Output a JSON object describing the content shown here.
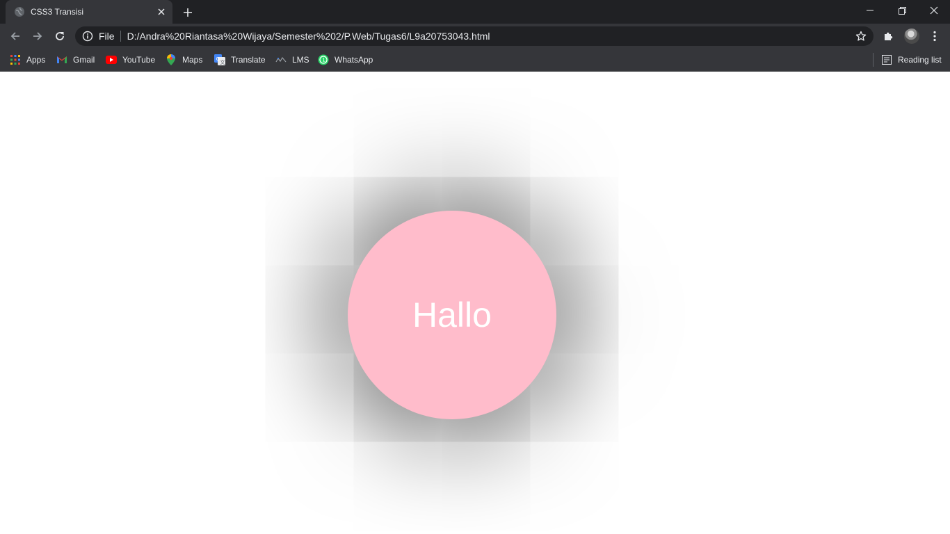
{
  "tab": {
    "title": "CSS3 Transisi",
    "favicon": "globe-icon"
  },
  "omnibox": {
    "scheme_label": "File",
    "url": "D:/Andra%20Riantasa%20Wijaya/Semester%202/P.Web/Tugas6/L9a20753043.html"
  },
  "bookmarks": {
    "items": [
      {
        "label": "Apps",
        "icon": "apps-grid-icon"
      },
      {
        "label": "Gmail",
        "icon": "gmail-icon"
      },
      {
        "label": "YouTube",
        "icon": "youtube-icon"
      },
      {
        "label": "Maps",
        "icon": "maps-icon"
      },
      {
        "label": "Translate",
        "icon": "translate-icon"
      },
      {
        "label": "LMS",
        "icon": "lms-icon"
      },
      {
        "label": "WhatsApp",
        "icon": "whatsapp-icon"
      }
    ],
    "reading_list_label": "Reading list"
  },
  "page": {
    "circle_text": "Hallo"
  },
  "colors": {
    "circle_fill": "#ffbccb",
    "chrome_dark": "#202124",
    "chrome_toolbar": "#35363a"
  }
}
